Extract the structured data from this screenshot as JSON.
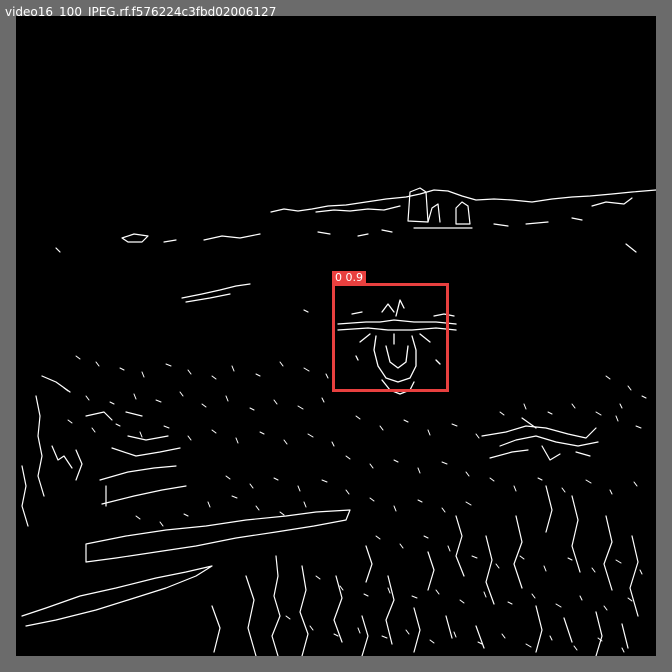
{
  "image": {
    "filename": "video16_100_JPEG.rf.f576224c3fbd02006127"
  },
  "detection": {
    "label": "0 0.9",
    "color": "#e8403f"
  },
  "colors": {
    "frame": "#6b6b6b",
    "background": "#000000",
    "edges": "#ffffff"
  }
}
